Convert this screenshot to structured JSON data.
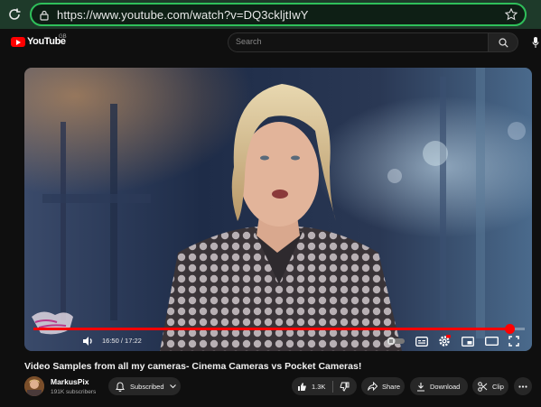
{
  "browser": {
    "url": "https://www.youtube.com/watch?v=DQ3ckljtIwY"
  },
  "header": {
    "logo_text": "YouTube",
    "region": "GB",
    "search_placeholder": "Search"
  },
  "player": {
    "current_time": "16:50",
    "duration": "17:22",
    "time_display": "16:50 / 17:22",
    "progress_fraction": 0.969,
    "accent_color": "#ff0000"
  },
  "video": {
    "title": "Video Samples from all my cameras- Cinema Cameras vs Pocket Cameras!"
  },
  "channel": {
    "name": "MarkusPix",
    "subscribers": "191K subscribers",
    "subscribe_label": "Subscribed"
  },
  "actions": {
    "likes": "1.3K",
    "share": "Share",
    "download": "Download",
    "clip": "Clip"
  }
}
